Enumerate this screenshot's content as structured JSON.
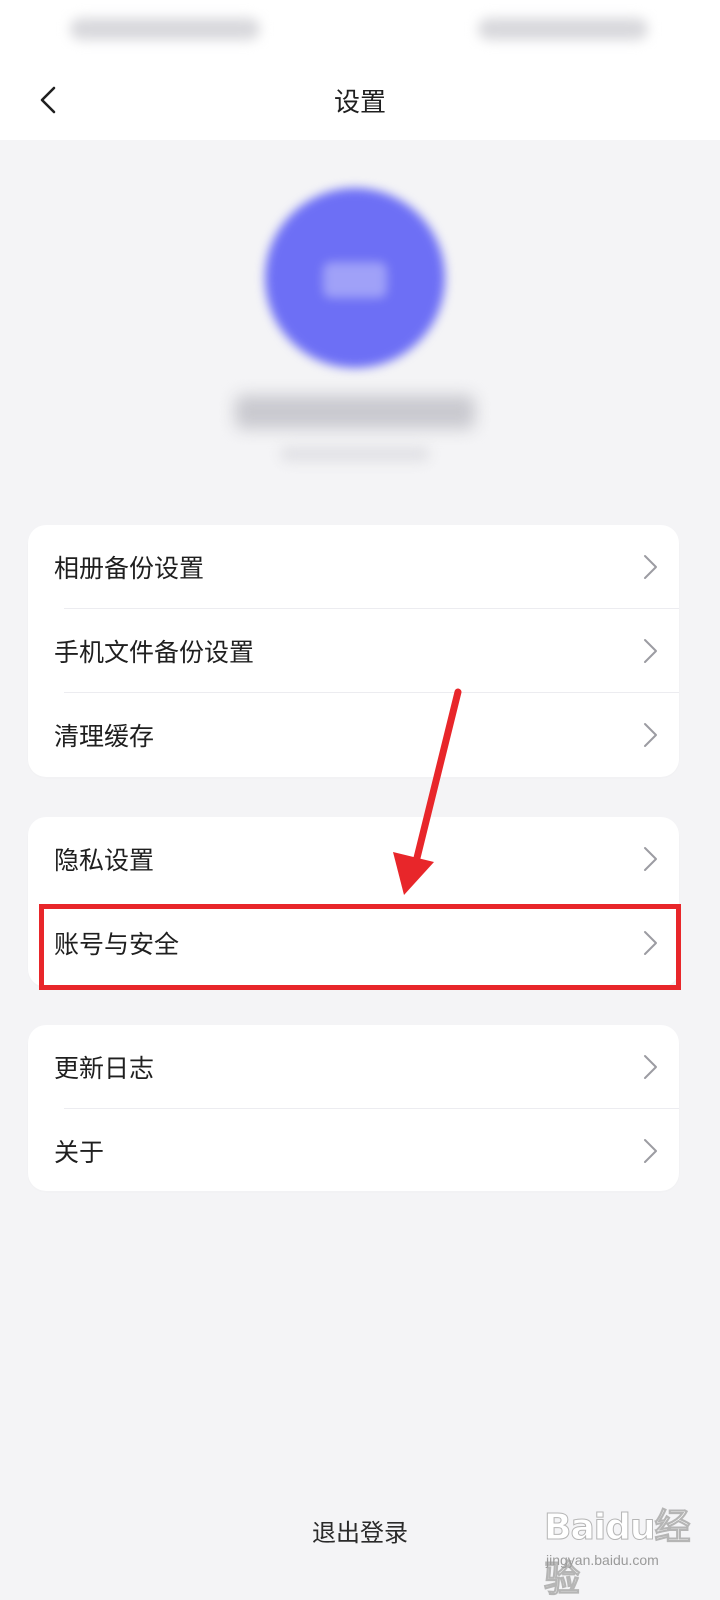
{
  "header": {
    "title": "设置"
  },
  "groups": [
    {
      "items": [
        {
          "label": "相册备份设置"
        },
        {
          "label": "手机文件备份设置"
        },
        {
          "label": "清理缓存"
        }
      ]
    },
    {
      "items": [
        {
          "label": "隐私设置"
        },
        {
          "label": "账号与安全"
        }
      ]
    },
    {
      "items": [
        {
          "label": "更新日志"
        },
        {
          "label": "关于"
        }
      ]
    }
  ],
  "footer": {
    "logout_label": "退出登录"
  },
  "watermark": {
    "logo_text": "Baidu经验",
    "url": "jingyan.baidu.com"
  },
  "colors": {
    "accent_avatar": "#6d6ff5",
    "annotation_red": "#e8262a",
    "background": "#f4f4f6",
    "card": "#ffffff"
  }
}
